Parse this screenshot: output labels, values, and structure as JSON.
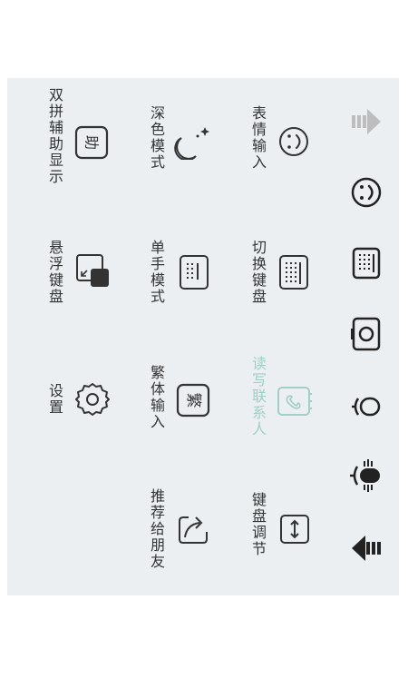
{
  "colors": {
    "panel_bg": "#eceff2",
    "icon": "#333333",
    "disabled": "#9fcfc7"
  },
  "toolbar": [
    {
      "name": "forward-arrow-icon"
    },
    {
      "name": "emoji-icon"
    },
    {
      "name": "keyboard-icon"
    },
    {
      "name": "camera-icon"
    },
    {
      "name": "microphone-icon"
    },
    {
      "name": "voice-recording-icon"
    },
    {
      "name": "back-arrow-icon"
    }
  ],
  "menu": {
    "emoji_input": "表情输入",
    "switch_keyboard": "切换键盘",
    "read_contacts": "读写联系人",
    "keyboard_adjust": "键盘调节",
    "dark_mode": "深色模式",
    "one_hand_mode": "单手模式",
    "traditional_input": "繁体输入",
    "recommend_friends": "推荐给朋友",
    "shuangpin_display": "双拼辅助显示",
    "float_keyboard": "悬浮键盘",
    "settings": "设置",
    "traditional_icon_char": "繁",
    "shuangpin_icon_char": "助"
  }
}
